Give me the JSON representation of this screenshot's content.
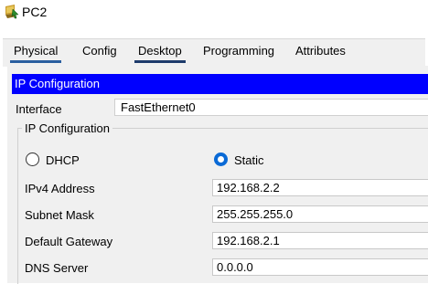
{
  "window": {
    "title": "PC2"
  },
  "tabs": [
    {
      "label": "Physical"
    },
    {
      "label": "Config"
    },
    {
      "label": "Desktop"
    },
    {
      "label": "Programming"
    },
    {
      "label": "Attributes"
    }
  ],
  "ip_config": {
    "header": "IP Configuration",
    "interface_label": "Interface",
    "interface_value": "FastEthernet0",
    "group_title": "IP Configuration",
    "dhcp_label": "DHCP",
    "static_label": "Static",
    "mode_selected": "Static",
    "ipv4_label": "IPv4 Address",
    "ipv4_value": "192.168.2.2",
    "subnet_label": "Subnet Mask",
    "subnet_value": "255.255.255.0",
    "gateway_label": "Default Gateway",
    "gateway_value": "192.168.2.1",
    "dns_label": "DNS Server",
    "dns_value": "0.0.0.0"
  },
  "colors": {
    "header_bar": "#0000ff",
    "radio_selected": "#0a6ad6",
    "active_tab_underline": "#2a5fa0"
  },
  "icons": {
    "app": "pc-device-icon"
  }
}
